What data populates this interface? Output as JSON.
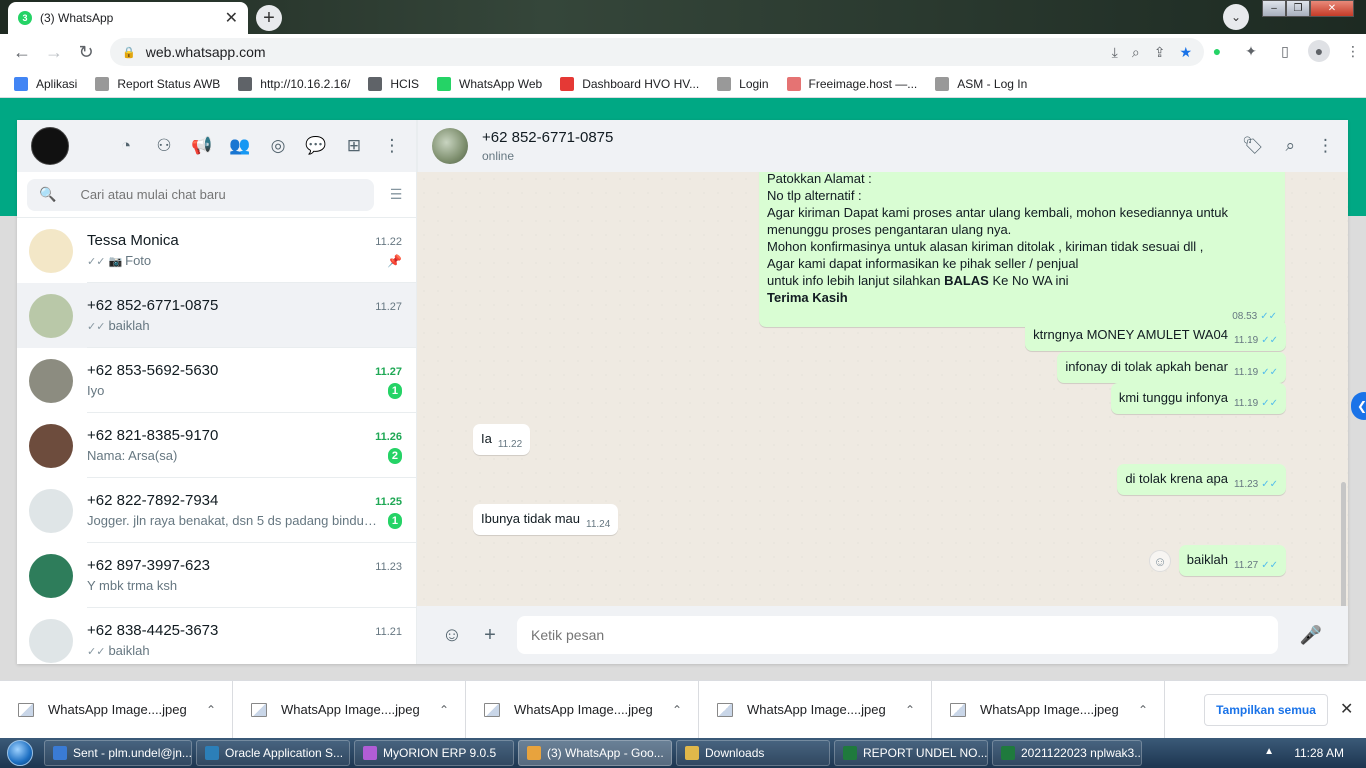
{
  "browser": {
    "tab_title": "(3) WhatsApp",
    "tab_badge": "3",
    "url": "web.whatsapp.com",
    "bookmarks": [
      {
        "label": "Aplikasi",
        "color": "#4285f4"
      },
      {
        "label": "Report Status AWB",
        "color": "#999999"
      },
      {
        "label": "http://10.16.2.16/",
        "color": "#5f6368"
      },
      {
        "label": "HCIS",
        "color": "#5f6368"
      },
      {
        "label": "WhatsApp Web",
        "color": "#25d366"
      },
      {
        "label": "Dashboard HVO HV...",
        "color": "#e53935"
      },
      {
        "label": "Login",
        "color": "#999999"
      },
      {
        "label": "Freeimage.host —...",
        "color": "#e57373"
      },
      {
        "label": "ASM - Log In",
        "color": "#999999"
      }
    ]
  },
  "sidebar": {
    "search_placeholder": "Cari atau mulai chat baru",
    "chats": [
      {
        "name": "Tessa Monica",
        "time": "11.22",
        "preview": "Foto",
        "ticks": "✓✓",
        "photo": true,
        "pinned": true,
        "unread": "",
        "avatar": "#f3e7c7"
      },
      {
        "name": "+62 852-6771-0875",
        "time": "11.27",
        "preview": "baiklah",
        "ticks": "✓✓",
        "photo": false,
        "pinned": false,
        "unread": "",
        "avatar": "#b9c8a8",
        "active": true
      },
      {
        "name": "+62 853-5692-5630",
        "time": "11.27",
        "preview": "Iyo",
        "ticks": "",
        "photo": false,
        "pinned": false,
        "unread": "1",
        "avatar": "#8c8c80"
      },
      {
        "name": "+62 821-8385-9170",
        "time": "11.26",
        "preview": "Nama: Arsa(sa)",
        "ticks": "",
        "photo": false,
        "pinned": false,
        "unread": "2",
        "avatar": "#6d4c3d"
      },
      {
        "name": "+62 822-7892-7934",
        "time": "11.25",
        "preview": "Jogger. jln raya benakat, dsn 5  ds padang bindu ...",
        "ticks": "",
        "photo": false,
        "pinned": false,
        "unread": "1",
        "avatar": "#dfe5e7"
      },
      {
        "name": "+62 897-3997-623",
        "time": "11.23",
        "preview": "Y mbk trma ksh",
        "ticks": "",
        "photo": false,
        "pinned": false,
        "unread": "",
        "avatar": "#2e7d5b"
      },
      {
        "name": "+62 838-4425-3673",
        "time": "11.21",
        "preview": "baiklah",
        "ticks": "✓✓",
        "photo": false,
        "pinned": false,
        "unread": "",
        "avatar": "#dfe5e7"
      }
    ]
  },
  "conversation": {
    "contact_name": "+62 852-6771-0875",
    "status": "online",
    "long_message": {
      "lines": [
        "Patokkan Alamat :",
        "No tlp alternatif :",
        "Agar kiriman Dapat kami proses antar ulang kembali, mohon kesediannya untuk",
        "menunggu proses pengantaran ulang nya.",
        "Mohon konfirmasinya untuk alasan kiriman ditolak , kiriman tidak sesuai dll ,",
        "Agar kami dapat informasikan ke pihak seller / penjual"
      ],
      "balas_prefix": "untuk info lebih lanjut silahkan ",
      "balas_bold": "BALAS",
      "balas_suffix": " Ke No WA ini",
      "closing": "Terima Kasih",
      "time": "08.53"
    },
    "messages": [
      {
        "text": "ktrngnya MONEY AMULET WA04",
        "time": "11.19",
        "dir": "out"
      },
      {
        "text": "infonay di tolak apkah benar",
        "time": "11.19",
        "dir": "out"
      },
      {
        "text": "kmi tunggu infonya",
        "time": "11.19",
        "dir": "out"
      },
      {
        "text": "Ia",
        "time": "11.22",
        "dir": "in"
      },
      {
        "text": "di tolak krena apa",
        "time": "11.23",
        "dir": "out"
      },
      {
        "text": "Ibunya tidak mau",
        "time": "11.24",
        "dir": "in"
      },
      {
        "text": "baiklah",
        "time": "11.27",
        "dir": "out"
      }
    ],
    "composer_placeholder": "Ketik pesan"
  },
  "downloads": {
    "items": [
      "WhatsApp Image....jpeg",
      "WhatsApp Image....jpeg",
      "WhatsApp Image....jpeg",
      "WhatsApp Image....jpeg",
      "WhatsApp Image....jpeg"
    ],
    "show_all": "Tampilkan semua"
  },
  "taskbar": {
    "items": [
      {
        "label": "Sent - plm.undel@jn...",
        "color": "#3a7bd5"
      },
      {
        "label": "Oracle Application S...",
        "color": "#2c7fb8"
      },
      {
        "label": "MyORION ERP 9.0.5",
        "color": "#b15dd6"
      },
      {
        "label": "(3) WhatsApp - Goo...",
        "color": "#e8a33d",
        "active": true
      },
      {
        "label": "Downloads",
        "color": "#e0b84a"
      },
      {
        "label": "REPORT UNDEL NO...",
        "color": "#1f7a3d"
      },
      {
        "label": "2021122023 nplwak3...",
        "color": "#1f7a3d"
      }
    ],
    "clock": "11:28 AM"
  }
}
